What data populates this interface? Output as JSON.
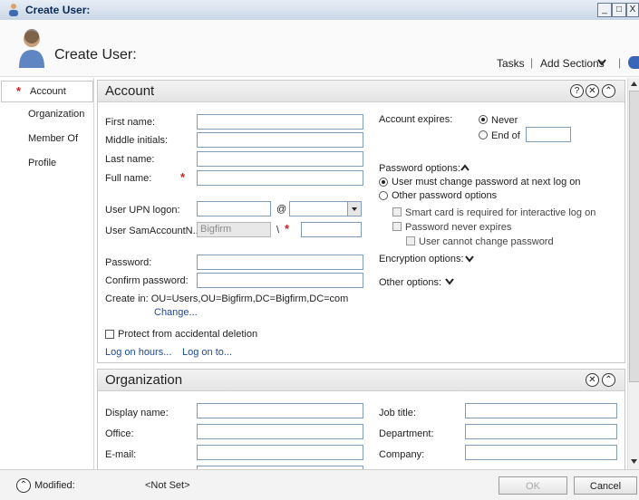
{
  "window": {
    "title": "Create User:",
    "minimize": "_",
    "maximize": "□",
    "close": "X"
  },
  "header": {
    "title": "Create User:",
    "tasks": "Tasks",
    "add_sections": "Add Sections",
    "sep": "|"
  },
  "nav": {
    "items": [
      {
        "label": "Account",
        "active": true,
        "required": true
      },
      {
        "label": "Organization"
      },
      {
        "label": "Member Of"
      },
      {
        "label": "Profile"
      }
    ]
  },
  "account": {
    "title": "Account",
    "first_name": "First name:",
    "middle_initials": "Middle initials:",
    "last_name": "Last name:",
    "full_name": "Full name:",
    "upn_logon": "User UPN logon:",
    "at": "@",
    "sam_account": "User SamAccountN...",
    "sam_domain": "Bigfirm",
    "backslash": "\\",
    "password": "Password:",
    "confirm_password": "Confirm password:",
    "create_in": "Create in:  OU=Users,OU=Bigfirm,DC=Bigfirm,DC=com",
    "change": "Change...",
    "protect": "Protect from accidental deletion",
    "log_on_hours": "Log on hours...",
    "log_on_to": "Log on to...",
    "account_expires": "Account expires:",
    "never": "Never",
    "end_of": "End of",
    "password_options": "Password options:",
    "must_change": "User must change password at next log on",
    "other_pw_options": "Other password options",
    "smart_card": "Smart card is required for interactive log on",
    "never_expires": "Password never expires",
    "cannot_change": "User cannot change password",
    "encryption_options": "Encryption options:",
    "other_options": "Other options:"
  },
  "organization": {
    "title": "Organization",
    "display_name": "Display name:",
    "office": "Office:",
    "email": "E-mail:",
    "job_title": "Job title:",
    "department": "Department:",
    "company": "Company:"
  },
  "footer": {
    "modified_label": "Modified:",
    "modified_value": "<Not Set>",
    "ok": "OK",
    "cancel": "Cancel"
  },
  "icons": {
    "help": "help-icon",
    "close": "close-circle-icon",
    "collapse": "collapse-icon"
  }
}
